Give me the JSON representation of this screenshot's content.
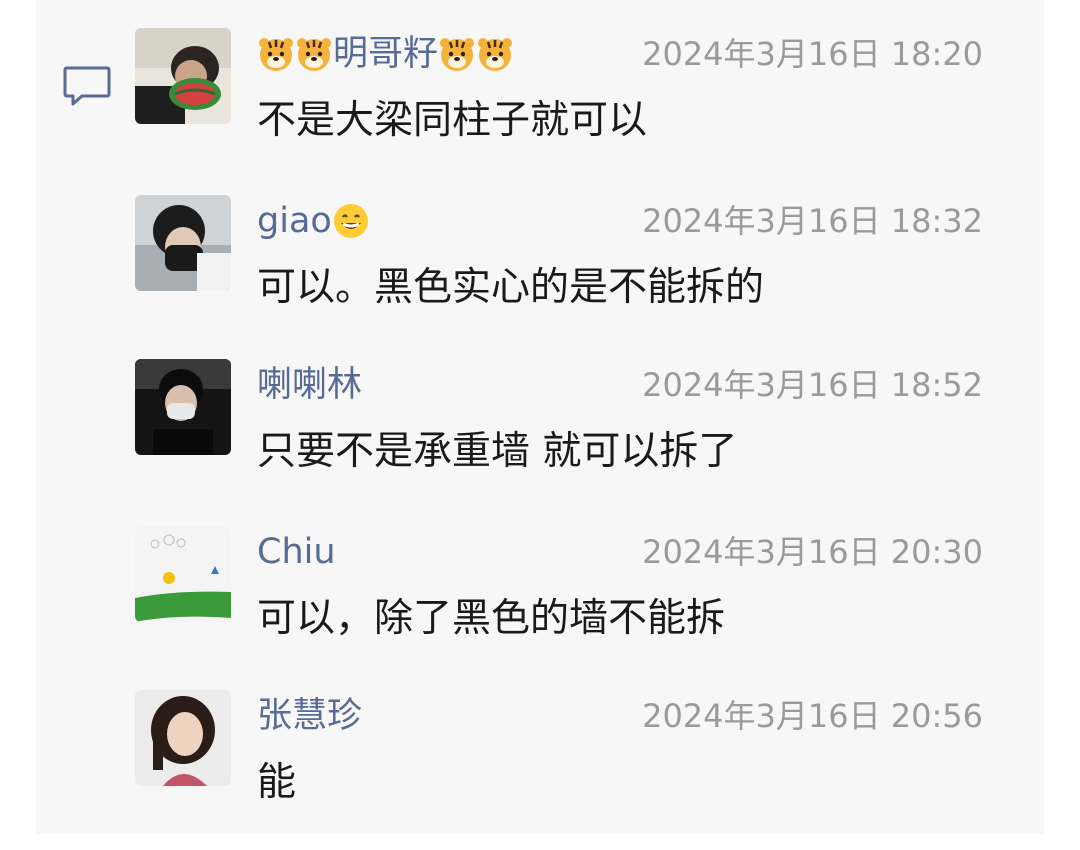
{
  "comments": [
    {
      "name": "明哥籽",
      "name_prefix_icons": [
        "tiger-face-emoji",
        "tiger-face-emoji"
      ],
      "name_suffix_icons": [
        "tiger-face-emoji",
        "tiger-face-emoji"
      ],
      "time": "2024年3月16日 18:20",
      "text": "不是大梁同柱子就可以"
    },
    {
      "name": "giao",
      "name_suffix_icons": [
        "grinning-face-emoji"
      ],
      "time": "2024年3月16日 18:32",
      "text": "可以。黑色实心的是不能拆的"
    },
    {
      "name": "喇喇林",
      "time": "2024年3月16日 18:52",
      "text": "只要不是承重墙 就可以拆了"
    },
    {
      "name": "Chiu",
      "time": "2024年3月16日 20:30",
      "text": "可以，除了黑色的墙不能拆"
    },
    {
      "name": "张慧珍",
      "time": "2024年3月16日 20:56",
      "text": "能"
    }
  ],
  "colors": {
    "name": "#576b95",
    "time": "#9a9a9a",
    "text": "#1a1a1a",
    "panel": "#f7f7f7"
  }
}
